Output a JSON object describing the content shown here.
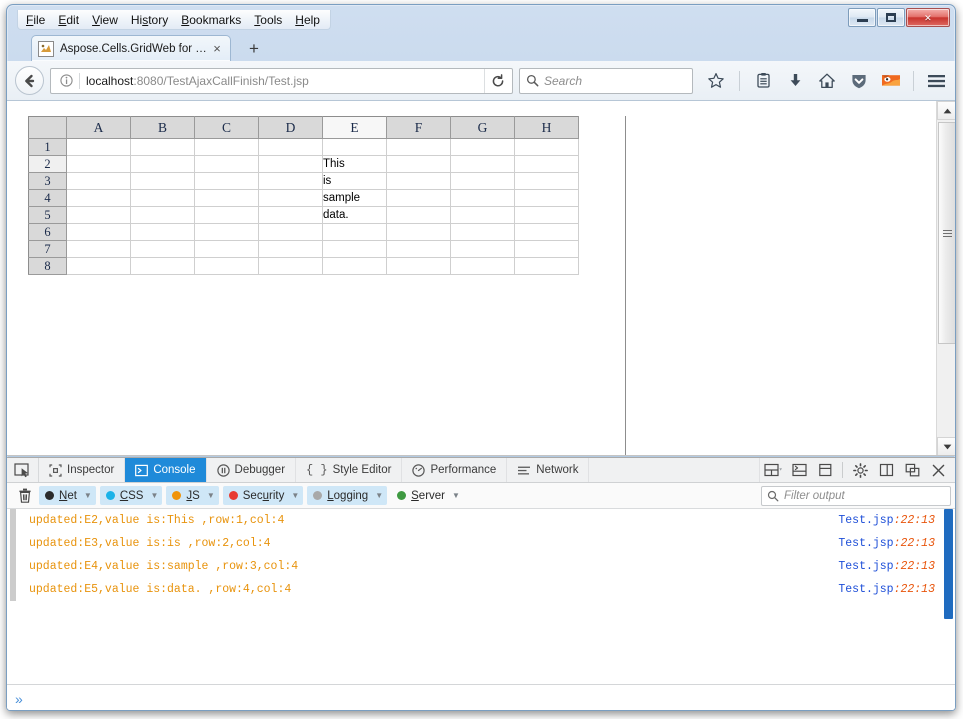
{
  "window": {
    "controls": {
      "minimize": "minimize-button",
      "maximize": "maximize-button",
      "close": "×"
    }
  },
  "menubar": {
    "items": [
      {
        "label": "File",
        "accel": "F"
      },
      {
        "label": "Edit",
        "accel": "E"
      },
      {
        "label": "View",
        "accel": "V"
      },
      {
        "label": "History",
        "accel": "s"
      },
      {
        "label": "Bookmarks",
        "accel": "B"
      },
      {
        "label": "Tools",
        "accel": "T"
      },
      {
        "label": "Help",
        "accel": "H"
      }
    ]
  },
  "tabstrip": {
    "tabs": [
      {
        "title": "Aspose.Cells.GridWeb for J...",
        "favicon": "page-favicon",
        "close": "×"
      }
    ],
    "new_tab": "+"
  },
  "navbar": {
    "back_icon": "back-arrow-icon",
    "identity_icon": "info-icon",
    "url_host": "localhost",
    "url_path": ":8080/TestAjaxCallFinish/Test.jsp",
    "reload_icon": "reload-icon",
    "search_placeholder": "Search",
    "search_icon": "search-icon",
    "icons": [
      "bookmark-star-icon",
      "reader-list-icon",
      "downloads-icon",
      "home-icon",
      "pocket-shield-icon",
      "firefox-account-icon"
    ],
    "menu_icon": "hamburger-menu-icon"
  },
  "spreadsheet": {
    "columns": [
      "A",
      "B",
      "C",
      "D",
      "E",
      "F",
      "G",
      "H"
    ],
    "selected_column": "E",
    "rows": [
      "1",
      "2",
      "3",
      "4",
      "5",
      "6",
      "7",
      "8"
    ],
    "selected_row": "2",
    "cells": {
      "E2": "This",
      "E3": "is",
      "E4": "sample",
      "E5": "data."
    }
  },
  "scrollbar": {
    "up_arrow": "▲",
    "down_arrow": "▼"
  },
  "devtools": {
    "picker_icon": "element-picker-icon",
    "tabs": [
      {
        "label": "Inspector",
        "icon": "inspector-icon",
        "active": false
      },
      {
        "label": "Console",
        "icon": "console-icon",
        "active": true
      },
      {
        "label": "Debugger",
        "icon": "debugger-icon",
        "active": false
      },
      {
        "label": "Style Editor",
        "icon": "style-editor-icon",
        "active": false
      },
      {
        "label": "Performance",
        "icon": "performance-icon",
        "active": false
      },
      {
        "label": "Network",
        "icon": "network-icon",
        "active": false
      }
    ],
    "toolbar_buttons": [
      "responsive-design-mode-icon",
      "split-console-icon",
      "select-iframe-icon",
      "settings-gear-icon",
      "dock-side-icon",
      "dock-separate-window-icon",
      "close-devtools-icon"
    ],
    "active_tab_color": "#1f8ad9",
    "clear_icon": "trash-clear-icon",
    "filters": [
      {
        "label": "Net",
        "accel": "N",
        "color": "#2b2b2b",
        "active": true
      },
      {
        "label": "CSS",
        "accel": "C",
        "color": "#1bb2e8",
        "active": true
      },
      {
        "label": "JS",
        "accel": "J",
        "color": "#f0940a",
        "active": true
      },
      {
        "label": "Security",
        "accel": "u",
        "color": "#e83b33",
        "active": true
      },
      {
        "label": "Logging",
        "accel": "L",
        "color": "#a9a9a9",
        "active": true
      },
      {
        "label": "Server",
        "accel": "S",
        "color": "#3f9a42",
        "active": false
      }
    ],
    "filter_input": {
      "placeholder": "Filter output",
      "icon": "search-icon"
    },
    "console_messages": [
      {
        "text": "updated:E2,value is:This ,row:1,col:4",
        "file": "Test.jsp",
        "position": ":22:13"
      },
      {
        "text": "updated:E3,value is:is ,row:2,col:4",
        "file": "Test.jsp",
        "position": ":22:13"
      },
      {
        "text": "updated:E4,value is:sample ,row:3,col:4",
        "file": "Test.jsp",
        "position": ":22:13"
      },
      {
        "text": "updated:E5,value is:data. ,row:4,col:4",
        "file": "Test.jsp",
        "position": ":22:13"
      }
    ],
    "message_color": "#e8930c",
    "file_link_color": "#1e4fd8",
    "input_prompt": "»"
  }
}
